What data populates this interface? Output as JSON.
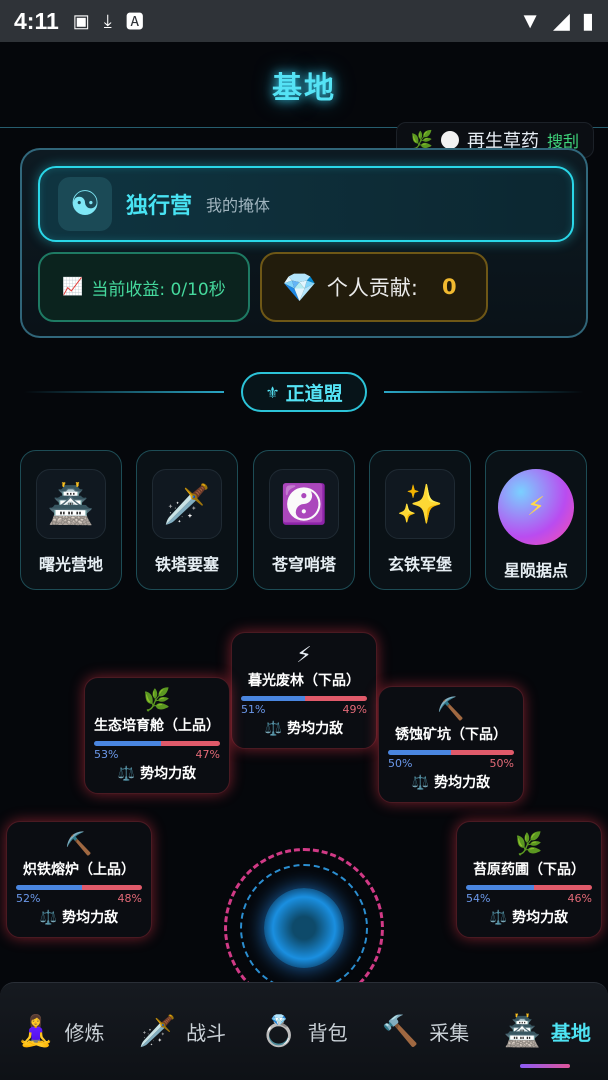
{
  "status_bar": {
    "time": "4:11"
  },
  "header": {
    "title": "基地"
  },
  "herb": {
    "name": "再生草药",
    "action": "搜刮"
  },
  "camp": {
    "name": "独行营",
    "subtitle": "我的掩体",
    "income_label": "当前收益: 0/10秒",
    "contribution_label": "个人贡献:",
    "contribution_value": "0"
  },
  "alliance": {
    "label": "正道盟"
  },
  "tiles": [
    {
      "label": "曙光营地",
      "icon": "castle-icon"
    },
    {
      "label": "铁塔要塞",
      "icon": "dagger-icon"
    },
    {
      "label": "苍穹哨塔",
      "icon": "yin-yang-icon"
    },
    {
      "label": "玄铁军堡",
      "icon": "sparkles-icon"
    },
    {
      "label": "星陨据点",
      "icon": "lightning-icon"
    }
  ],
  "nodes": [
    {
      "name": "暮光废林（下品）",
      "blue": "51%",
      "red": "49%",
      "blue_frac": 0.51,
      "state": "势均力敌",
      "icon": "lightning-icon"
    },
    {
      "name": "生态培育舱（上品）",
      "blue": "53%",
      "red": "47%",
      "blue_frac": 0.53,
      "state": "势均力敌",
      "icon": "herb-icon"
    },
    {
      "name": "锈蚀矿坑（下品）",
      "blue": "50%",
      "red": "50%",
      "blue_frac": 0.5,
      "state": "势均力敌",
      "icon": "pickaxe-icon"
    },
    {
      "name": "炽铁熔炉（上品）",
      "blue": "52%",
      "red": "48%",
      "blue_frac": 0.52,
      "state": "势均力敌",
      "icon": "pickaxe-icon"
    },
    {
      "name": "苔原药圃（下品）",
      "blue": "54%",
      "red": "46%",
      "blue_frac": 0.54,
      "state": "势均力敌",
      "icon": "herb-icon"
    }
  ],
  "nav": [
    {
      "label": "修炼",
      "icon": "meditation-icon"
    },
    {
      "label": "战斗",
      "icon": "dagger-icon"
    },
    {
      "label": "背包",
      "icon": "ring-icon"
    },
    {
      "label": "采集",
      "icon": "hammer-icon"
    },
    {
      "label": "基地",
      "icon": "castle-icon"
    }
  ],
  "colors": {
    "accent": "#55e3f5",
    "contribution": "#f1b930",
    "income": "#45d99d",
    "bar_blue": "#4a86e0",
    "bar_red": "#e05a6a"
  }
}
